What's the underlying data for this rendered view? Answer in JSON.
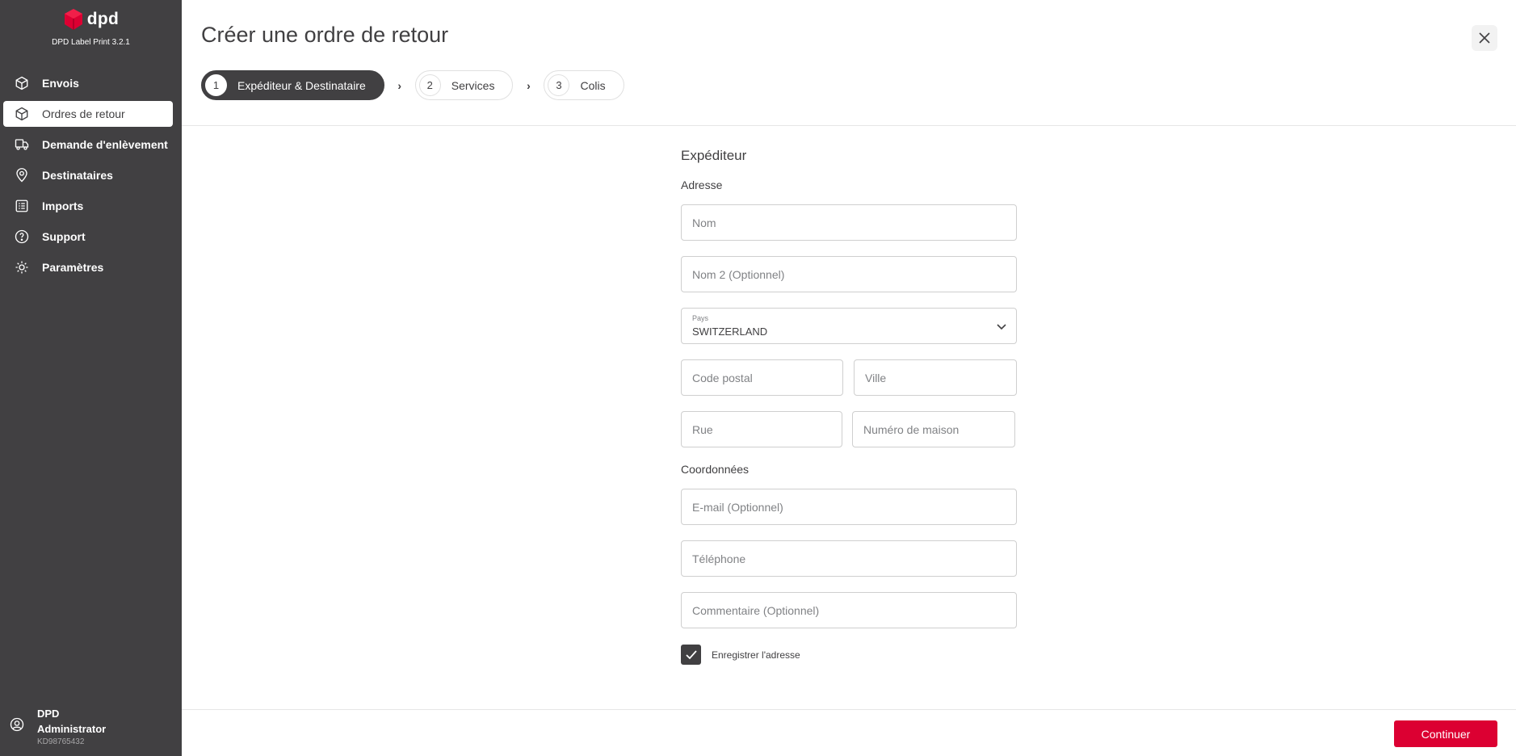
{
  "app": {
    "logo_text": "dpd",
    "version": "DPD Label Print 3.2.1",
    "brand_color": "#dc0032",
    "sidebar_bg": "#414042"
  },
  "sidebar": {
    "items": [
      {
        "label": "Envois",
        "icon": "package-icon"
      },
      {
        "label": "Ordres de retour",
        "icon": "package-icon",
        "active": true
      },
      {
        "label": "Demande d'enlèvement",
        "icon": "truck-icon"
      },
      {
        "label": "Destinataires",
        "icon": "location-pin-icon"
      },
      {
        "label": "Imports",
        "icon": "list-icon"
      },
      {
        "label": "Support",
        "icon": "help-icon"
      },
      {
        "label": "Paramètres",
        "icon": "gear-icon"
      }
    ],
    "user": {
      "name_line1": "DPD",
      "name_line2": "Administrator",
      "id": "KD98765432",
      "icon": "user-icon"
    }
  },
  "header": {
    "title": "Créer une ordre de retour",
    "close_icon": "close-icon"
  },
  "steps": [
    {
      "num": "1",
      "label": "Expéditeur & Destinataire",
      "active": true
    },
    {
      "num": "2",
      "label": "Services"
    },
    {
      "num": "3",
      "label": "Colis"
    }
  ],
  "form": {
    "section_title": "Expéditeur",
    "address_heading": "Adresse",
    "name_placeholder": "Nom",
    "name2_placeholder": "Nom 2 (Optionnel)",
    "country_label": "Pays",
    "country_value": "SWITZERLAND",
    "postal_placeholder": "Code postal",
    "city_placeholder": "Ville",
    "street_placeholder": "Rue",
    "house_placeholder": "Numéro de maison",
    "contact_heading": "Coordonnées",
    "email_placeholder": "E-mail (Optionnel)",
    "phone_placeholder": "Téléphone",
    "comment_placeholder": "Commentaire (Optionnel)",
    "save_address_label": "Enregistrer l'adresse",
    "save_address_checked": true
  },
  "footer": {
    "continue_label": "Continuer"
  }
}
